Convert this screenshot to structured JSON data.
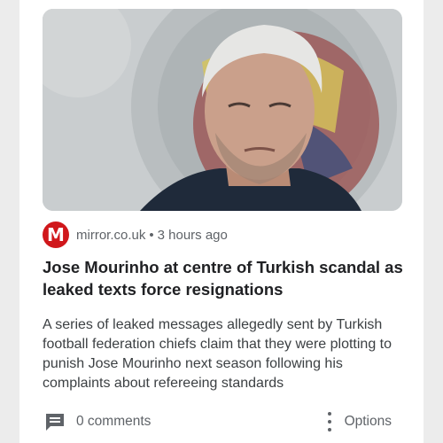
{
  "article": {
    "image_alt_icon": "person-photo",
    "source": {
      "logo_letter": "M",
      "name": "mirror.co.uk",
      "separator": "•",
      "time": "3 hours ago"
    },
    "headline": "Jose Mourinho at centre of Turkish scandal as leaked texts force resignations",
    "summary": "A series of leaked messages allegedly sent by Turkish football federation chiefs claim that they were plotting to punish Jose Mourinho next season following his complaints about refereeing standards"
  },
  "footer": {
    "comments_label": "0 comments",
    "options_label": "Options"
  },
  "colors": {
    "brand_red": "#d0171b",
    "text_primary": "#202124",
    "text_secondary": "#5f6368"
  }
}
